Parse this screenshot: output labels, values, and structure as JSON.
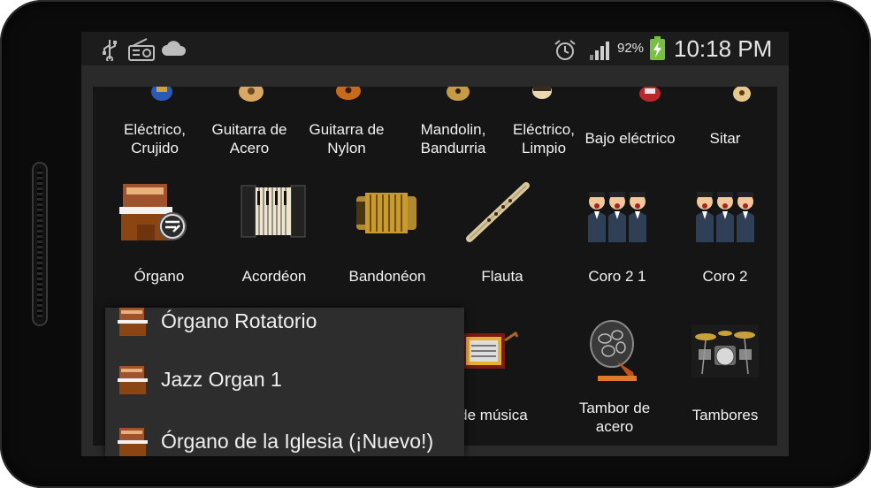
{
  "status_bar": {
    "left_icons": [
      "usb-icon",
      "radio-icon",
      "cloud-icon"
    ],
    "right_icons": [
      "alarm-icon",
      "signal-icon",
      "battery-charging-icon"
    ],
    "battery_percent": "92%",
    "time": "10:18 PM",
    "battery_color": "#77c043"
  },
  "instruments": {
    "row1": [
      {
        "label": "Eléctrico,\nCrujido",
        "icon": "electric-guitar-icon"
      },
      {
        "label": "Guitarra de\nAcero",
        "icon": "steel-guitar-icon"
      },
      {
        "label": "Guitarra de\nNylon",
        "icon": "nylon-guitar-icon"
      },
      {
        "label": "Mandolin,\nBandurria",
        "icon": "mandolin-icon"
      },
      {
        "label": "Eléctrico,\nLimpio",
        "icon": "electric-guitar-clean-icon"
      },
      {
        "label": "Bajo eléctrico",
        "icon": "electric-bass-icon"
      },
      {
        "label": "Sitar",
        "icon": "sitar-icon"
      }
    ],
    "row2": [
      {
        "label": "Órgano",
        "icon": "organ-icon"
      },
      {
        "label": "Acordéon",
        "icon": "accordion-icon"
      },
      {
        "label": "Bandonéon",
        "icon": "bandoneon-icon"
      },
      {
        "label": "Flauta",
        "icon": "flute-icon"
      },
      {
        "label": "Coro 2 1",
        "icon": "choir-icon"
      },
      {
        "label": "Coro 2",
        "icon": "choir-icon"
      }
    ],
    "row3": [
      {
        "label": "a de música",
        "icon": "music-box-icon"
      },
      {
        "label": "Tambor de\nacero",
        "icon": "steel-drum-icon"
      },
      {
        "label": "Tambores",
        "icon": "drums-icon"
      }
    ]
  },
  "popup": {
    "items": [
      {
        "label": "Órgano Rotatorio",
        "icon": "organ-small-icon"
      },
      {
        "label": "Jazz Organ 1",
        "icon": "organ-small-icon"
      },
      {
        "label": "Órgano de la Iglesia (¡Nuevo!)",
        "icon": "organ-small-icon"
      }
    ]
  }
}
